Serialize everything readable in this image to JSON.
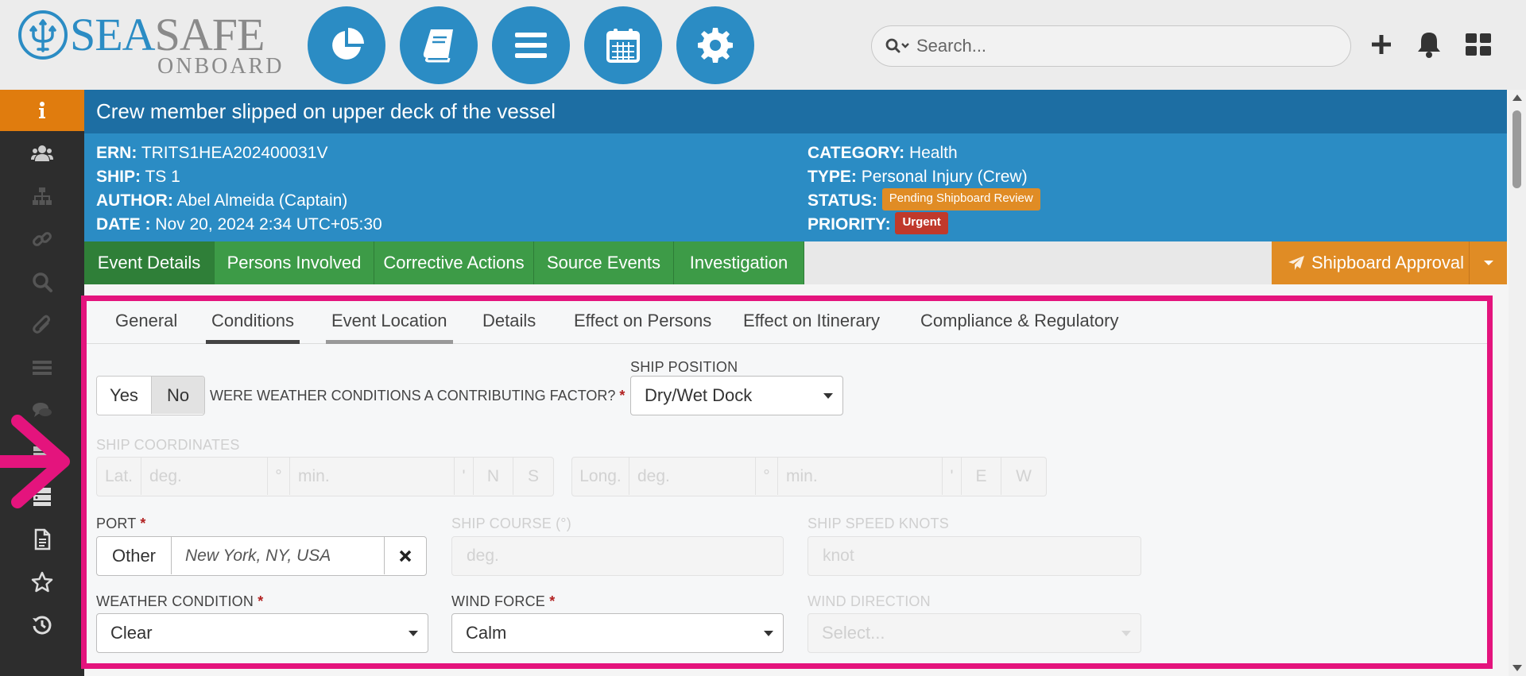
{
  "brand": {
    "name_part1": "SEA",
    "name_part2": "SAFE",
    "subtitle": "ONBOARD"
  },
  "nav": [
    "dashboard-pie-icon",
    "book-icon",
    "menu-icon",
    "calendar-icon",
    "gear-icon"
  ],
  "search": {
    "placeholder": "Search..."
  },
  "header_actions": [
    "plus-icon",
    "bell-icon",
    "grid-icon"
  ],
  "sidebar": [
    "info-icon",
    "users-icon",
    "sitemap-icon",
    "link-icon",
    "search-icon",
    "paperclip-icon",
    "list-icon",
    "comments-icon",
    "server-icon",
    "server-icon",
    "file-icon",
    "star-icon",
    "history-icon"
  ],
  "event": {
    "title": "Crew member slipped on upper deck of the vessel",
    "ern_label": "ERN:",
    "ern": "TRITS1HEA202400031V",
    "ship_label": "SHIP:",
    "ship": "TS 1",
    "author_label": "AUTHOR:",
    "author": "Abel Almeida (Captain)",
    "date_label": "DATE :",
    "date": "Nov 20, 2024 2:34 UTC+05:30",
    "category_label": "CATEGORY:",
    "category": "Health",
    "type_label": "TYPE:",
    "type": "Personal Injury (Crew)",
    "status_label": "STATUS:",
    "status": "Pending Shipboard Review",
    "priority_label": "PRIORITY:",
    "priority": "Urgent"
  },
  "main_tabs": [
    {
      "label": "Event Details",
      "active": true
    },
    {
      "label": "Persons Involved"
    },
    {
      "label": "Corrective Actions"
    },
    {
      "label": "Source Events"
    },
    {
      "label": "Investigation"
    }
  ],
  "approval_button": {
    "label": "Shipboard Approval"
  },
  "sub_tabs": [
    {
      "label": "General"
    },
    {
      "label": "Conditions",
      "active": true
    },
    {
      "label": "Event Location"
    },
    {
      "label": "Details"
    },
    {
      "label": "Effect on Persons"
    },
    {
      "label": "Effect on Itinerary"
    },
    {
      "label": "Compliance & Regulatory"
    }
  ],
  "form": {
    "weather_factor": {
      "yes": "Yes",
      "no": "No",
      "selected": "No",
      "label": "WERE WEATHER CONDITIONS A CONTRIBUTING FACTOR?",
      "required": "*"
    },
    "ship_position": {
      "label": "SHIP POSITION",
      "value": "Dry/Wet Dock"
    },
    "ship_coordinates": {
      "label": "SHIP COORDINATES",
      "lat": "Lat.",
      "lat_deg": "deg.",
      "deg_sym": "°",
      "lat_min": "min.",
      "min_sym": "'",
      "n": "N",
      "s": "S",
      "long": "Long.",
      "long_deg": "deg.",
      "long_min": "min.",
      "e": "E",
      "w": "W"
    },
    "port": {
      "label": "PORT",
      "required": "*",
      "prefix": "Other",
      "value": "New York, NY, USA"
    },
    "ship_course": {
      "label": "SHIP COURSE (°)",
      "placeholder": "deg."
    },
    "ship_speed": {
      "label": "SHIP SPEED KNOTS",
      "placeholder": "knot"
    },
    "weather_condition": {
      "label": "WEATHER CONDITION",
      "required": "*",
      "value": "Clear"
    },
    "wind_force": {
      "label": "WIND FORCE",
      "required": "*",
      "value": "Calm"
    },
    "wind_direction": {
      "label": "WIND DIRECTION",
      "placeholder": "Select..."
    }
  },
  "colors": {
    "primary": "#2b8cc4",
    "title_bar": "#1d6ea3",
    "tab_green": "#3d9b47",
    "orange": "#e08c25",
    "urgent": "#c0392b",
    "highlight": "#e4147d",
    "sidebar": "#2d2d2d"
  }
}
